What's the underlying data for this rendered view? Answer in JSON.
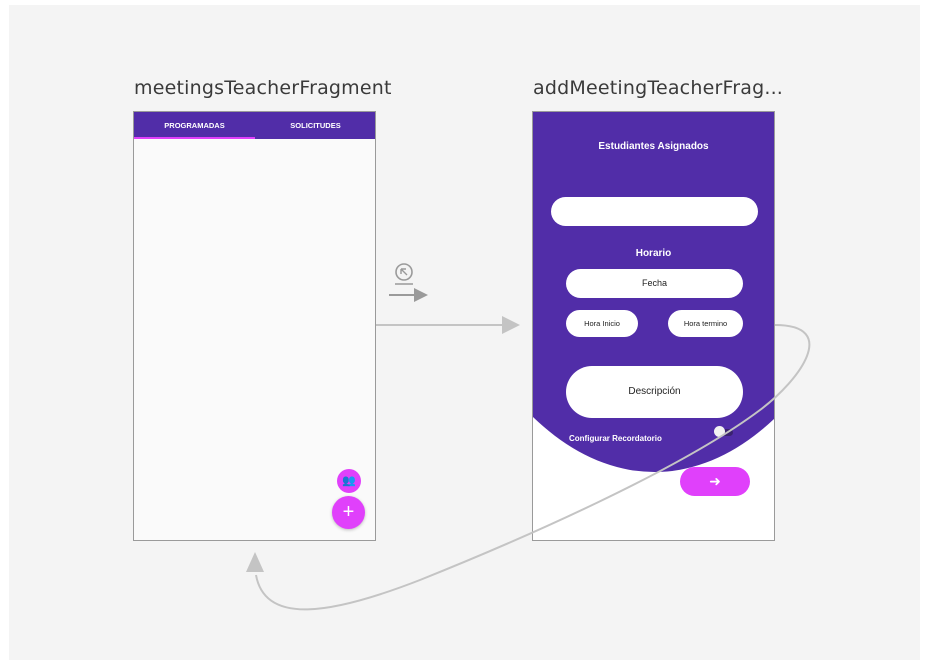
{
  "colors": {
    "primary": "#512da8",
    "accent": "#e040fb",
    "canvas": "#f4f4f4",
    "connector": "#c4c4c4"
  },
  "left_fragment": {
    "title": "meetingsTeacherFragment",
    "tabs": [
      "PROGRAMADAS",
      "SOLICITUDES"
    ],
    "fab_small_icon": "people-icon",
    "fab_small_glyph": "👥",
    "fab_icon": "plus-icon",
    "fab_glyph": "+"
  },
  "right_fragment": {
    "title": "addMeetingTeacherFrag...",
    "students_heading": "Estudiantes Asignados",
    "student_field_value": "",
    "schedule_heading": "Horario",
    "date_field": "Fecha",
    "start_time_field": "Hora Inicio",
    "end_time_field": "Hora termino",
    "description_field": "Descripción",
    "reminder_label": "Configurar Recordatorio",
    "reminder_enabled": false,
    "next_icon": "arrow-right-icon",
    "next_glyph": "➜"
  },
  "connections": {
    "navigation_action_icon": "action-icon"
  }
}
